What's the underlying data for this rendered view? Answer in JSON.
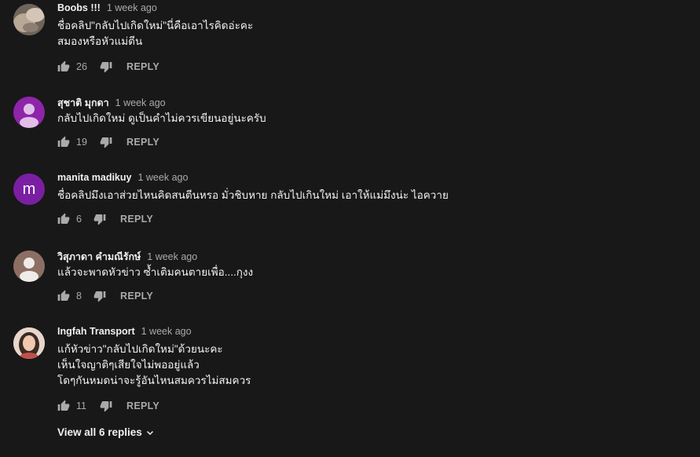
{
  "comments": [
    {
      "author": "Boobs !!!",
      "time": "1 week ago",
      "text": "ชื่อคลิป\"กลับไปเกิดใหม่\"นี่คือเอาไรคิดอ่ะคะ\nสมองหรือหัวแม่ตีน",
      "likes": "26",
      "reply_label": "REPLY",
      "avatar": {
        "type": "photo",
        "color": "#8a7a6a"
      }
    },
    {
      "author": "สุชาติ มุกดา",
      "time": "1 week ago",
      "text": "กลับไปเกิดใหม่ ดูเป็นคำไม่ควรเขียนอยู่นะครับ",
      "likes": "19",
      "reply_label": "REPLY",
      "avatar": {
        "type": "default",
        "color": "#8e24aa"
      }
    },
    {
      "author": "manita madikuy",
      "time": "1 week ago",
      "text": "ชื่อคลิปมึงเอาส่วยไหนคิดสนตีนหรอ มั่วชิบหาย กลับไปเกินใหม่ เอาให้แม่มึงน่ะ ไอควาย",
      "likes": "6",
      "reply_label": "REPLY",
      "avatar": {
        "type": "letter",
        "letter": "m",
        "color": "#7b1fa2"
      }
    },
    {
      "author": "วิสุภาดา คำมณีรักษ์",
      "time": "1 week ago",
      "text": "แล้วจะพาดหัวข่าว ซ้ำเติมคนตายเพื่อ....กุงง",
      "likes": "8",
      "reply_label": "REPLY",
      "avatar": {
        "type": "default",
        "color": "#8d6e63"
      }
    },
    {
      "author": "Ingfah Transport",
      "time": "1 week ago",
      "text": "แก้หัวข่าว\"กลับไปเกิดใหม่\"ด้วยนะคะ\nเห็นใจญาติๆเสียใจไม่พออยู่แล้ว\nโดๆกันหมดน่าจะรู้อันไหนสมควรไม่สมควร",
      "likes": "11",
      "reply_label": "REPLY",
      "avatar": {
        "type": "photo",
        "color": "#d9b3a0"
      }
    }
  ],
  "view_replies_label": "View all 6 replies",
  "icons": {
    "like": "thumb-up-icon",
    "dislike": "thumb-down-icon",
    "expand": "chevron-down-icon"
  },
  "colors": {
    "background": "#181818",
    "text_primary": "#f1f1f1",
    "text_secondary": "#aaaaaa"
  }
}
